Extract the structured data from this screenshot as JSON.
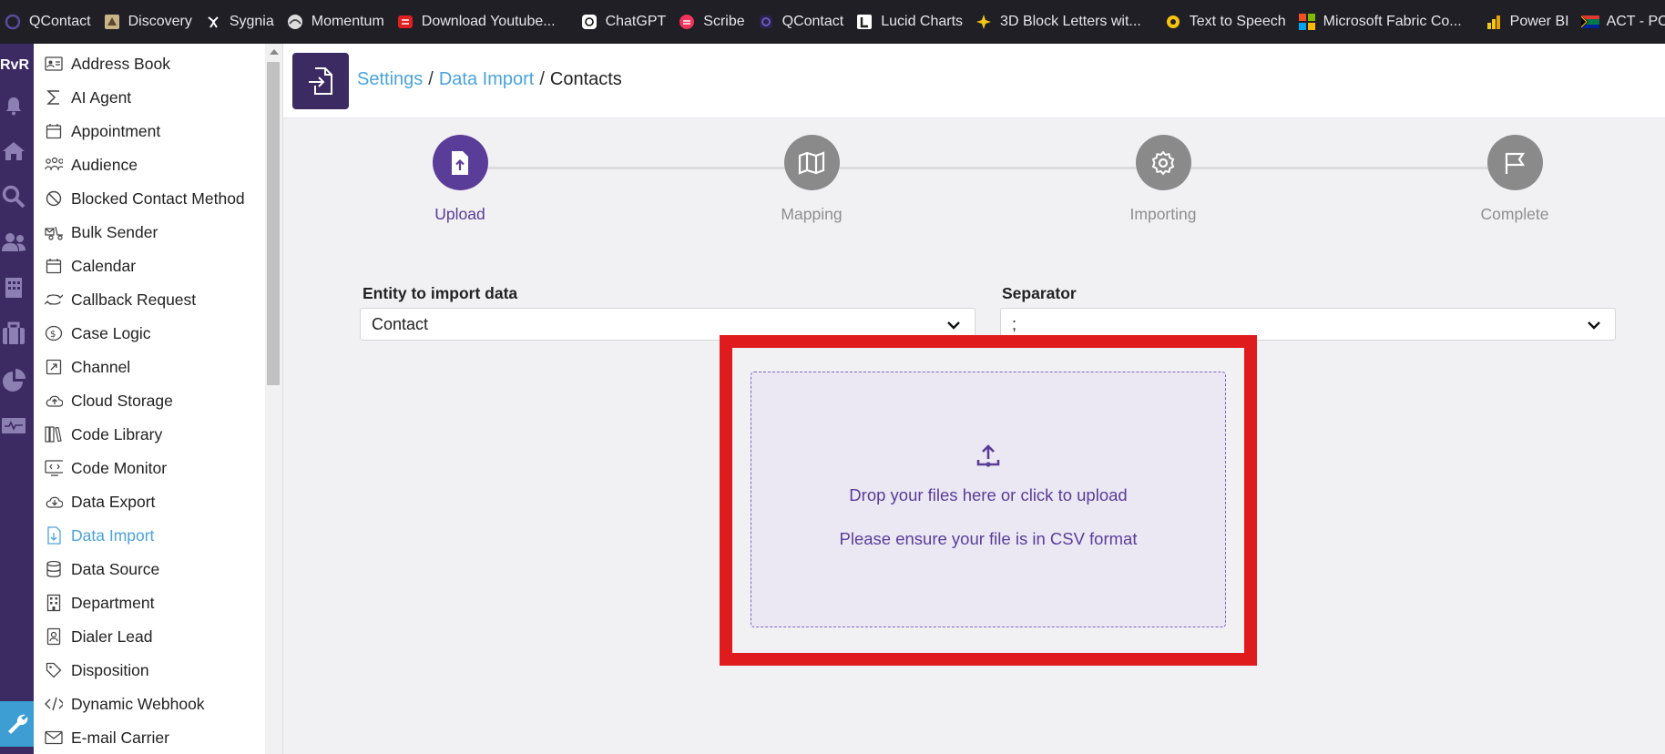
{
  "bookmarks": [
    {
      "label": "QContact",
      "icon": "qcontact-icon"
    },
    {
      "label": "Discovery",
      "icon": "discovery-icon"
    },
    {
      "label": "Sygnia",
      "icon": "sygnia-icon"
    },
    {
      "label": "Momentum",
      "icon": "momentum-icon"
    },
    {
      "label": "Download Youtube...",
      "icon": "download-youtube-icon"
    },
    {
      "label": "ChatGPT",
      "icon": "chatgpt-icon"
    },
    {
      "label": "Scribe",
      "icon": "scribe-icon"
    },
    {
      "label": "QContact",
      "icon": "qcontact-icon"
    },
    {
      "label": "Lucid Charts",
      "icon": "lucid-icon"
    },
    {
      "label": "3D Block Letters wit...",
      "icon": "sparkle-icon"
    },
    {
      "label": "Text to Speech",
      "icon": "tts-icon"
    },
    {
      "label": "Microsoft Fabric Co...",
      "icon": "microsoft-icon"
    },
    {
      "label": "Power BI",
      "icon": "powerbi-icon"
    },
    {
      "label": "ACT - POPIA",
      "icon": "flag-za-icon"
    }
  ],
  "rail": {
    "brand": "RvR"
  },
  "sidebar": {
    "items": [
      {
        "label": "Address Book",
        "icon": "address-book-icon"
      },
      {
        "label": "AI Agent",
        "icon": "sigma-icon"
      },
      {
        "label": "Appointment",
        "icon": "calendar-icon"
      },
      {
        "label": "Audience",
        "icon": "audience-icon"
      },
      {
        "label": "Blocked Contact Method",
        "icon": "blocked-icon"
      },
      {
        "label": "Bulk Sender",
        "icon": "bulk-sender-icon"
      },
      {
        "label": "Calendar",
        "icon": "calendar-icon"
      },
      {
        "label": "Callback Request",
        "icon": "callback-icon"
      },
      {
        "label": "Case Logic",
        "icon": "case-logic-icon"
      },
      {
        "label": "Channel",
        "icon": "channel-icon"
      },
      {
        "label": "Cloud Storage",
        "icon": "cloud-upload-icon"
      },
      {
        "label": "Code Library",
        "icon": "code-library-icon"
      },
      {
        "label": "Code Monitor",
        "icon": "code-monitor-icon"
      },
      {
        "label": "Data Export",
        "icon": "cloud-download-icon"
      },
      {
        "label": "Data Import",
        "icon": "file-import-icon",
        "active": true
      },
      {
        "label": "Data Source",
        "icon": "database-icon"
      },
      {
        "label": "Department",
        "icon": "building-icon"
      },
      {
        "label": "Dialer Lead",
        "icon": "contact-card-icon"
      },
      {
        "label": "Disposition",
        "icon": "tag-icon"
      },
      {
        "label": "Dynamic Webhook",
        "icon": "code-icon"
      },
      {
        "label": "E-mail Carrier",
        "icon": "envelope-icon"
      }
    ]
  },
  "breadcrumb": {
    "part1": "Settings",
    "sep1": "/",
    "part2": "Data Import",
    "sep2": "/",
    "part3": "Contacts"
  },
  "steps": [
    {
      "label": "Upload",
      "icon": "file-upload-icon",
      "current": true
    },
    {
      "label": "Mapping",
      "icon": "map-icon"
    },
    {
      "label": "Importing",
      "icon": "gear-icon"
    },
    {
      "label": "Complete",
      "icon": "flag-icon"
    }
  ],
  "form": {
    "entity_label": "Entity to import data",
    "entity_value": "Contact",
    "separator_label": "Separator",
    "separator_value": ";"
  },
  "dropzone": {
    "line1": "Drop your files here or click to upload",
    "line2": "Please ensure your file is in CSV format"
  },
  "colors": {
    "accent": "#5a3d98",
    "rail": "#3c2a63",
    "link": "#4aa3dc",
    "highlight": "#e01b1e"
  }
}
